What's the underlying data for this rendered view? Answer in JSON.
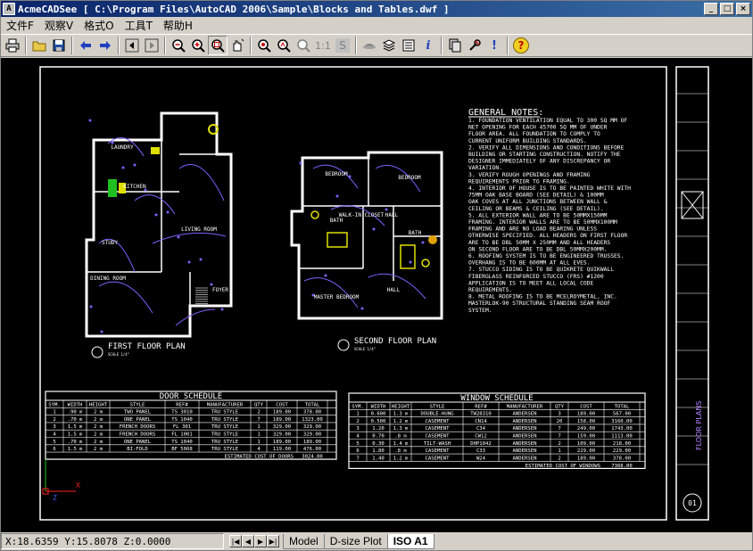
{
  "window": {
    "title": "AcmeCADSee [ C:\\Program Files\\AutoCAD 2006\\Sample\\Blocks and Tables.dwf ]",
    "app_icon": "A",
    "minimize": "_",
    "maximize": "□",
    "close": "×"
  },
  "menu": [
    "文件F",
    "观察V",
    "格式O",
    "工具T",
    "帮助H"
  ],
  "toolbar": {
    "buttons": [
      "printer-icon",
      "open-folder-icon",
      "save-icon",
      "back-arrow-icon",
      "forward-arrow-icon",
      "first-page-icon",
      "last-page-icon",
      "zoom-out-icon",
      "zoom-in-icon",
      "zoom-window-icon",
      "pan-icon",
      "zoom-extents-icon",
      "zoom-realtime-icon",
      "zoom-previous-icon",
      "actual-size-icon",
      "s-icon",
      "layers-icon",
      "layer-stack-icon",
      "properties-icon",
      "info-icon",
      "copy-icon",
      "tools-icon",
      "exclamation-icon",
      "help-icon"
    ],
    "labels": {
      "actual_size": "1:1",
      "s": "S",
      "info": "i",
      "exclaim": "!",
      "help": "?"
    }
  },
  "drawing": {
    "first_floor": "FIRST FLOOR PLAN",
    "second_floor": "SECOND FLOOR PLAN",
    "scale": "SCALE 1/4\"",
    "rooms": [
      "LAUNDRY",
      "KITCHEN",
      "LIVING ROOM",
      "STUDY",
      "DINING ROOM",
      "FOYER",
      "BEDROOM",
      "BEDROOM",
      "MASTER BEDROOM",
      "WALK-IN CLOSET",
      "BATH",
      "HALL",
      "HALL",
      "BATH",
      "BATH"
    ],
    "notes_title": "GENERAL NOTES:",
    "notes": [
      "1. FOUNDATION VENTILATION EQUAL TO 300 SQ MM OF",
      "   NET OPENING FOR EACH 45700 SQ MM OF UNDER",
      "   FLOOR AREA. ALL FOUNDATION TO COMPLY TO",
      "   CURRENT UNIFORM BUILDING STANDARDS.",
      "2. VERIFY ALL DIMENSIONS AND CONDITIONS BEFORE",
      "   BUILDING OR STARTING CONSTRUCTION. NOTIFY THE",
      "   DESIGNER IMMEDIATELY OF ANY DISCREPANCY OR",
      "   VARIATION.",
      "3. VERIFY ROUGH OPENINGS AND FRAMING",
      "   REQUIREMENTS PRIOR TO FRAMING.",
      "4. INTERIOR OF HOUSE IS TO BE PAINTED WHITE WITH",
      "   75MM OAK BASE BOARD (SEE DETAIL) & 100MM",
      "   OAK COVES AT ALL JUNCTIONS BETWEEN WALL &",
      "   CEILING OR BEAMS & CEILING (SEE DETAIL).",
      "5. ALL EXTERIOR WALL ARE TO BE 50MMX150MM",
      "   FRAMING. INTERIOR WALLS ARE TO BE 50MMX100MM",
      "   FRAMING AND ARE NO LOAD BEARING UNLESS",
      "   OTHERWISE SPECIFIED. ALL HEADERS ON FIRST FLOOR",
      "   ARE TO BE DBL 50MM X 250MM AND ALL HEADERS",
      "   ON SECOND FLOOR ARE TO BE DBL 50MMX200MM.",
      "6. ROOFING SYSTEM IS TO BE ENGINEERED TRUSSES.",
      "   OVERHANG IS TO BE 600MM AT ALL EVES.",
      "7. STUCCO SIDING IS TO BE QUIKRETE QUIKWALL",
      "   FIBERGLASS REINFORCED STUCCO (FRS) #1200",
      "   APPLICATION IS TO MEET ALL LOCAL CODE",
      "   REQUIREMENTS.",
      "8. METAL ROOFING IS TO BE MCELROYMETAL, INC.",
      "   MASTERLOK-90 STRUCTURAL STANDING SEAM ROOF",
      "   SYSTEM."
    ],
    "door_schedule": {
      "title": "DOOR SCHEDULE",
      "headers": [
        "SYM.",
        "WIDTH",
        "HEIGHT",
        "STYLE",
        "REF#",
        "MANUFACTURER",
        "QTY",
        "COST",
        "TOTAL"
      ],
      "rows": [
        [
          "1",
          ".90 m",
          "2 m",
          "TWO PANEL",
          "TS 3010",
          "TRU STYLE",
          "2",
          "189.00",
          "378.00"
        ],
        [
          "2",
          ".70 m",
          "2 m",
          "ONE PANEL",
          "TS 1040",
          "TRU STYLE",
          "7",
          "189.00",
          "1323.00"
        ],
        [
          "3",
          "1.5 m",
          "2 m",
          "FRENCH DOORS",
          "FL 301",
          "TRU STYLE",
          "1",
          "329.00",
          "329.00"
        ],
        [
          "4",
          "1.5 m",
          "2 m",
          "FRENCH DOORS",
          "FL 1001",
          "TRU STYLE",
          "1",
          "329.00",
          "329.00"
        ],
        [
          "5",
          ".70 m",
          "2 m",
          "ONE PANEL",
          "TS 1040",
          "TRU STYLE",
          "1",
          "189.00",
          "189.00"
        ],
        [
          "6",
          "1.5 m",
          "2 m",
          "BI-FOLD",
          "BF 5068",
          "TRU STYLE",
          "4",
          "119.00",
          "476.00"
        ]
      ],
      "footer_label": "ESTIMATED COST OF DOORS",
      "footer_value": "3024.00"
    },
    "window_schedule": {
      "title": "WINDOW SCHEDULE",
      "headers": [
        "SYM.",
        "WIDTH",
        "HEIGHT",
        "STYLE",
        "REF#",
        "MANUFACTURER",
        "QTY",
        "COST",
        "TOTAL"
      ],
      "rows": [
        [
          "1",
          "0.600",
          "1.3 m",
          "DOUBLE-HUNG",
          "TW28310",
          "ANDERSEN",
          "3",
          "189.00",
          "567.00"
        ],
        [
          "2",
          "0.500",
          "1.2 m",
          "CASEMENT",
          "CN14",
          "ANDERSEN",
          "20",
          "158.00",
          "3160.00"
        ],
        [
          "3",
          "1.20",
          "1.3 m",
          "CASEMENT",
          "C34",
          "ANDERSEN",
          "7",
          "249.00",
          "1743.00"
        ],
        [
          "4",
          "0.70",
          ".8 m",
          "CASEMENT",
          "CW12",
          "ANDERSEN",
          "7",
          "159.00",
          "1113.00"
        ],
        [
          "5",
          "0.30",
          "1.4 m",
          "TILT-WASH",
          "DHP1042",
          "ANDERSEN",
          "2",
          "109.00",
          "218.00"
        ],
        [
          "6",
          "1.80",
          ".8 m",
          "CASEMENT",
          "C33",
          "ANDERSEN",
          "1",
          "229.00",
          "229.00"
        ],
        [
          "7",
          "1.40",
          "1.2 m",
          "CASEMENT",
          "W24",
          "ANDERSEN",
          "2",
          "189.00",
          "378.00"
        ]
      ],
      "footer_label": "ESTIMATED COST OF WINDOWS",
      "footer_value": "7368.00"
    },
    "title_block_sheet": "FLOOR PLANS",
    "sheet_no": "01"
  },
  "status": {
    "coords": "X:18.6359 Y:15.8078 Z:0.0000",
    "tab_nav": [
      "|◀",
      "◀",
      "▶",
      "▶|"
    ],
    "tabs": [
      "Model",
      "D-size Plot",
      "ISO A1"
    ],
    "active_tab": 2
  }
}
